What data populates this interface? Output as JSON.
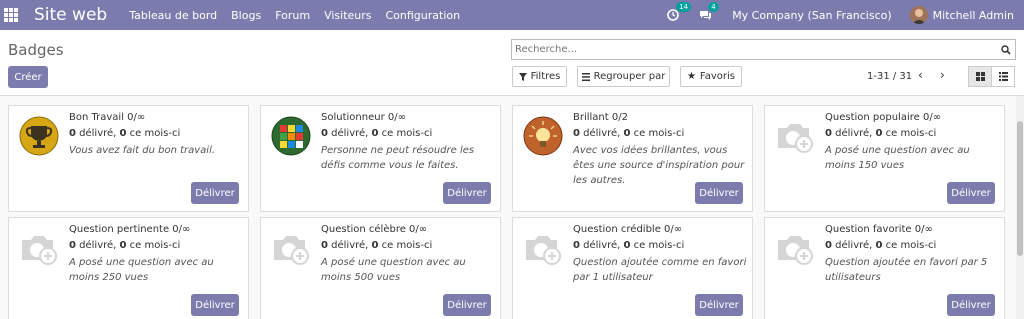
{
  "navbar": {
    "brand": "Site web",
    "menu": [
      "Tableau de bord",
      "Blogs",
      "Forum",
      "Visiteurs",
      "Configuration"
    ],
    "activity_count": "14",
    "messages_count": "4",
    "company": "My Company (San Francisco)",
    "user": "Mitchell Admin"
  },
  "control": {
    "title": "Badges",
    "create_label": "Créer",
    "search_placeholder": "Recherche...",
    "filters_label": "Filtres",
    "groupby_label": "Regrouper par",
    "favorites_label": "Favoris",
    "pager": "1-31 / 31"
  },
  "badges": [
    {
      "title": "Bon Travail 0/∞",
      "granted": "0",
      "granted_label": " délivré, ",
      "month": "0",
      "month_label": " ce mois-ci",
      "desc": "Vous avez fait du bon travail.",
      "icon": "trophy-icon",
      "deliver": "Délivrer"
    },
    {
      "title": "Solutionneur 0/∞",
      "granted": "0",
      "granted_label": " délivré, ",
      "month": "0",
      "month_label": " ce mois-ci",
      "desc": "Personne ne peut résoudre les défis comme vous le faites.",
      "icon": "rubik-cube-icon",
      "deliver": "Délivrer"
    },
    {
      "title": "Brillant 0/2",
      "granted": "0",
      "granted_label": " délivré, ",
      "month": "0",
      "month_label": " ce mois-ci",
      "desc": "Avec vos idées brillantes, vous êtes une source d'inspiration pour les autres.",
      "icon": "lightbulb-icon",
      "deliver": "Délivrer"
    },
    {
      "title": "Question populaire 0/∞",
      "granted": "0",
      "granted_label": " délivré, ",
      "month": "0",
      "month_label": " ce mois-ci",
      "desc": "A posé une question avec au moins 150 vues",
      "icon": "camera-placeholder-icon",
      "deliver": "Délivrer"
    },
    {
      "title": "Question pertinente 0/∞",
      "granted": "0",
      "granted_label": " délivré, ",
      "month": "0",
      "month_label": " ce mois-ci",
      "desc": "A posé une question avec au moins 250 vues",
      "icon": "camera-placeholder-icon",
      "deliver": "Délivrer"
    },
    {
      "title": "Question célèbre 0/∞",
      "granted": "0",
      "granted_label": " délivré, ",
      "month": "0",
      "month_label": " ce mois-ci",
      "desc": "A posé une question avec au moins 500 vues",
      "icon": "camera-placeholder-icon",
      "deliver": "Délivrer"
    },
    {
      "title": "Question crédible 0/∞",
      "granted": "0",
      "granted_label": " délivré, ",
      "month": "0",
      "month_label": " ce mois-ci",
      "desc": "Question ajoutée comme en favori par 1 utilisateur",
      "icon": "camera-placeholder-icon",
      "deliver": "Délivrer"
    },
    {
      "title": "Question favorite 0/∞",
      "granted": "0",
      "granted_label": " délivré, ",
      "month": "0",
      "month_label": " ce mois-ci",
      "desc": "Question ajoutée en favori par 5 utilisateurs",
      "icon": "camera-placeholder-icon",
      "deliver": "Délivrer"
    }
  ],
  "colors": {
    "accent": "#7c7bad",
    "teal": "#00a09d"
  }
}
